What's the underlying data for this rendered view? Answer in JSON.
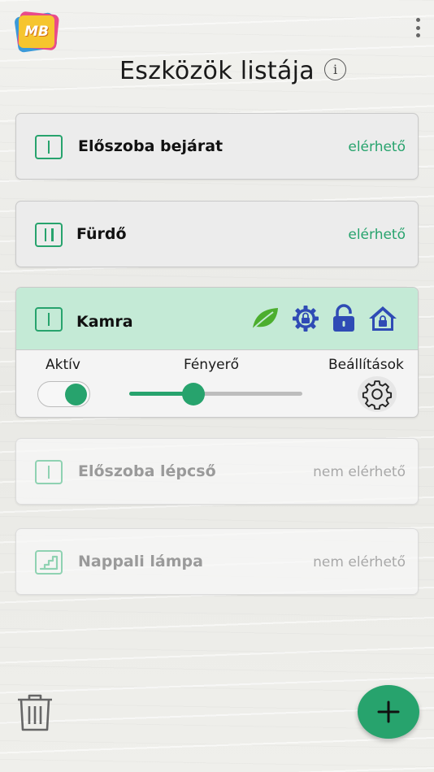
{
  "app": {
    "logo_text": "MB"
  },
  "header": {
    "title": "Eszközök listája",
    "info_icon": "info-icon",
    "menu_icon": "more-vert-icon"
  },
  "devices": [
    {
      "name": "Előszoba bejárat",
      "status": "elérhető",
      "icon": "single-switch-icon",
      "available": true
    },
    {
      "name": "Fürdő",
      "status": "elérhető",
      "icon": "double-switch-icon",
      "available": true
    },
    {
      "name": "Kamra",
      "icon": "single-switch-icon",
      "available": true,
      "expanded": true,
      "status_icons": [
        "leaf-icon",
        "lock-gear-icon",
        "padlock-icon",
        "home-lock-icon"
      ]
    },
    {
      "name": "Előszoba lépcső",
      "status": "nem elérhető",
      "icon": "single-switch-icon",
      "available": false
    },
    {
      "name": "Nappali lámpa",
      "status": "nem elérhető",
      "icon": "stairs-icon",
      "available": false
    }
  ],
  "controls": {
    "active_label": "Aktív",
    "active": true,
    "brightness_label": "Fényerő",
    "brightness": 0.37,
    "settings_label": "Beállítások"
  },
  "footer": {
    "delete_icon": "trash-icon",
    "add_icon": "plus-icon"
  },
  "colors": {
    "accent": "#27a36d",
    "expanded_header": "#c4ead6",
    "status_icon_blue": "#2f4bb5",
    "leaf_green": "#4cae2e"
  }
}
